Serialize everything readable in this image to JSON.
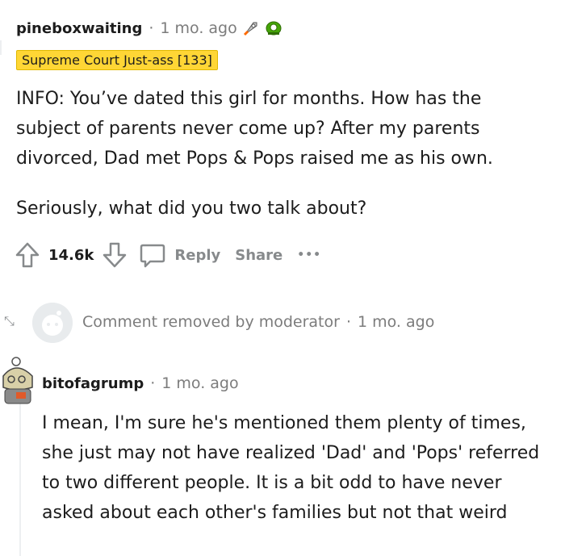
{
  "comment1": {
    "author": "pineboxwaiting",
    "time": "1 mo. ago",
    "flair": "Supreme Court Just-ass [133]",
    "paragraphs": [
      "INFO: You’ve dated this girl for months. How has the subject of parents never come up? After my parents divorced, Dad met Pops & Pops raised me as his own.",
      "Seriously, what did you two talk about?"
    ],
    "score": "14.6k",
    "reply_label": "Reply",
    "share_label": "Share",
    "more_label": "•••",
    "awards": [
      "rocket-award-icon",
      "money-award-icon"
    ]
  },
  "removed": {
    "text": "Comment removed by moderator",
    "time": "1 mo. ago"
  },
  "comment2": {
    "author": "bitofagrump",
    "time": "1 mo. ago",
    "body": "I mean, I'm sure he's mentioned them plenty of times, she just may not have realized 'Dad' and 'Pops' referred to two different people. It is a bit odd to have never asked about each other's families but not that weird"
  },
  "colors": {
    "flair_bg": "#ffd635",
    "meta_gray": "#7c7c7c",
    "action_gray": "#878a8c"
  }
}
